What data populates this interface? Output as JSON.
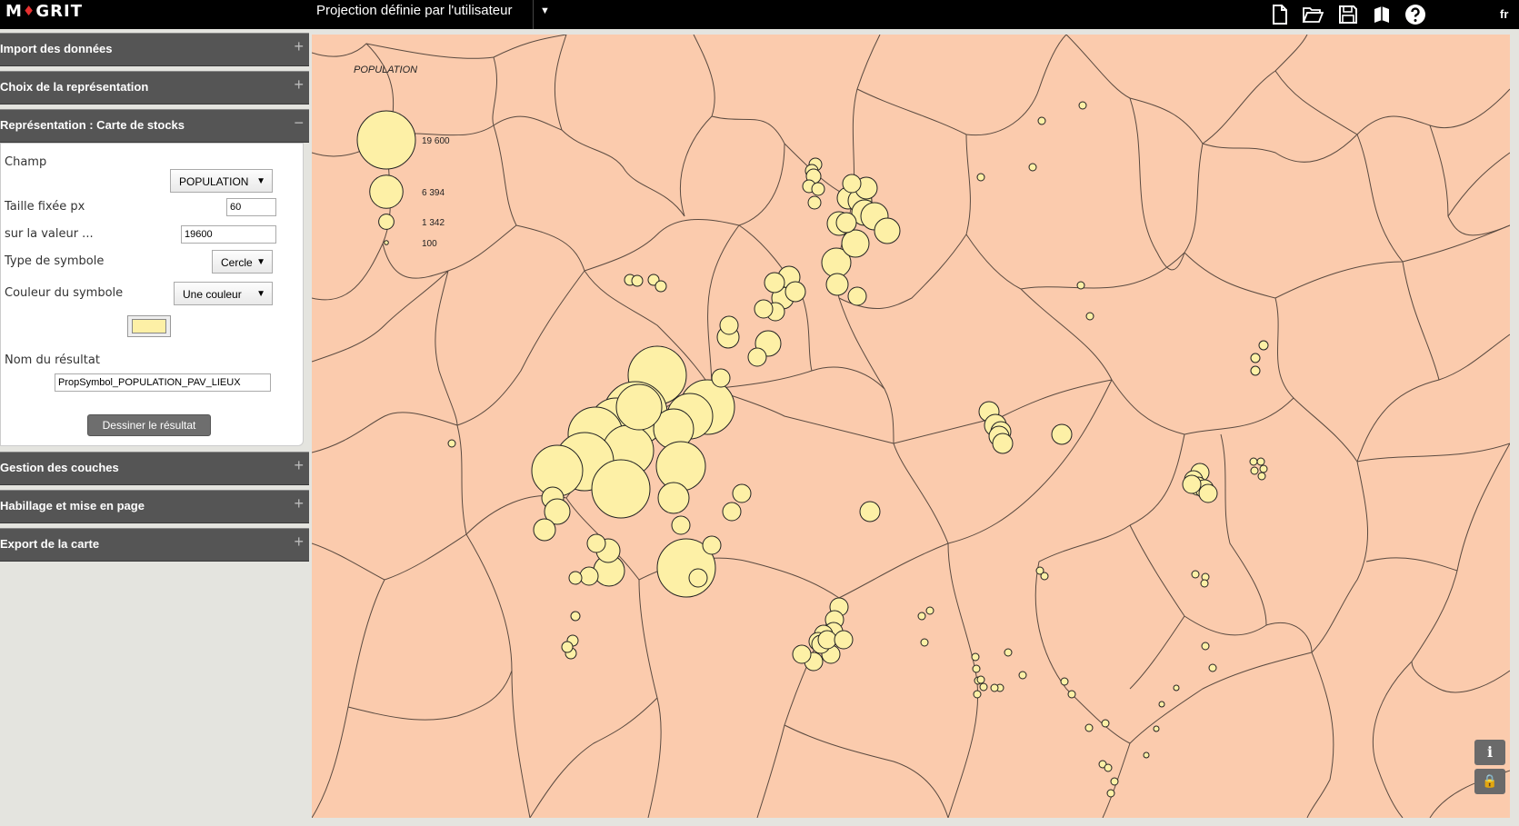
{
  "app": {
    "logo_text_left": "M",
    "logo_text_right": "GRIT",
    "logo_drop": "♦",
    "projection_label": "Projection définie par l'utilisateur",
    "language": "fr"
  },
  "toolbar_icons": [
    "new-file-icon",
    "open-folder-icon",
    "save-icon",
    "book-icon",
    "help-icon"
  ],
  "sidebar": {
    "sections": [
      {
        "label": "Import des données",
        "toggle": "+"
      },
      {
        "label": "Choix de la représentation",
        "toggle": "+"
      },
      {
        "label": "Représentation : Carte de stocks",
        "toggle": "−"
      },
      {
        "label": "Gestion des couches",
        "toggle": "+"
      },
      {
        "label": "Habillage et mise en page",
        "toggle": "+"
      },
      {
        "label": "Export de la carte",
        "toggle": "+"
      }
    ]
  },
  "stock_panel": {
    "field_label": "Champ",
    "field_value": "POPULATION",
    "fixed_size_label": "Taille fixée px",
    "fixed_size_value": "60",
    "on_value_label": "sur la valeur ...",
    "on_value_value": "19600",
    "symbol_type_label": "Type de symbole",
    "symbol_type_value": "Cercle",
    "symbol_color_label": "Couleur du symbole",
    "symbol_color_value": "Une couleur",
    "symbol_color_hex": "#fdf0a6",
    "result_name_label": "Nom du résultat",
    "result_name_value": "PropSymbol_POPULATION_PAV_LIEUX",
    "draw_button_label": "Dessiner le résultat"
  },
  "legend": {
    "title": "POPULATION",
    "entries": [
      {
        "value": 19600,
        "label": "19 600"
      },
      {
        "value": 6394,
        "label": "6 394"
      },
      {
        "value": 1342,
        "label": "1 342"
      },
      {
        "value": 100,
        "label": "100"
      }
    ]
  },
  "map_controls": {
    "info_label": "i"
  },
  "colors": {
    "map_background": "#fbcbad",
    "symbol_fill": "#fdf0a6",
    "boundary_stroke": "#5a4a40",
    "header_bg": "#555555",
    "topbar_bg": "#000000"
  }
}
